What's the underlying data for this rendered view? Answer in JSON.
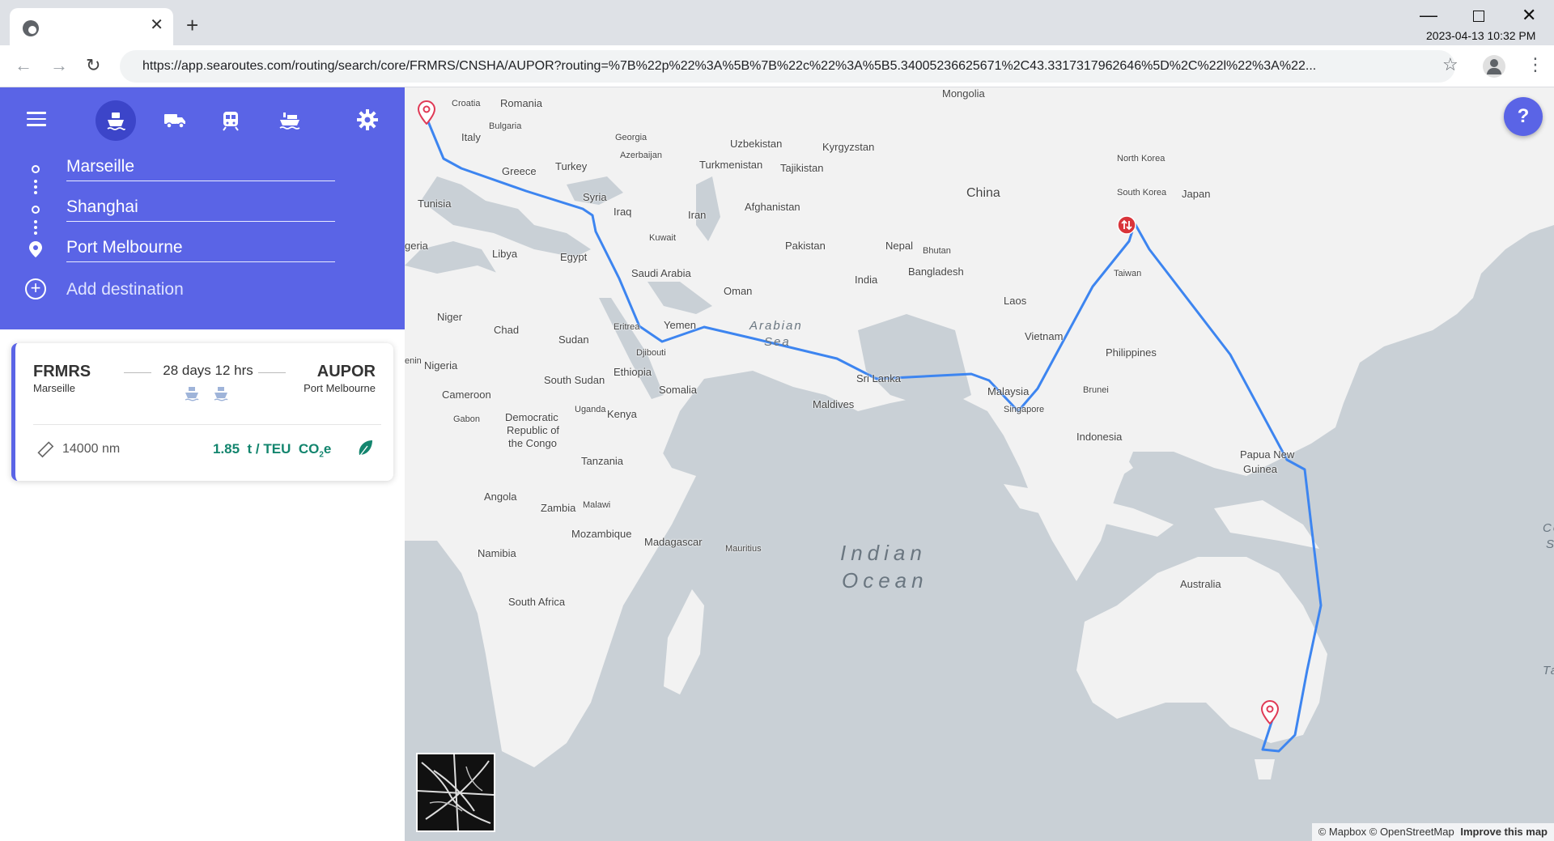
{
  "browser": {
    "tab_close": "✕",
    "new_tab": "+",
    "url": "https://app.searoutes.com/routing/search/core/FRMRS/CNSHA/AUPOR?routing=%7B%22p%22%3A%5B%7B%22c%22%3A%5B5.34005236625671%2C43.3317317962646%5D%2C%22l%22%3A%22...",
    "clock": "2023-04-13 10:32 PM",
    "icons": [
      "favicon-icon",
      "back-icon",
      "forward-icon",
      "reload-icon",
      "star-icon",
      "profile-icon",
      "menu-icon"
    ]
  },
  "sidebar": {
    "modes": [
      "ship-icon",
      "truck-icon",
      "train-icon",
      "port-icon"
    ],
    "waypoints": [
      {
        "label": "Marseille"
      },
      {
        "label": "Shanghai"
      },
      {
        "label": "Port Melbourne"
      }
    ],
    "add_destination": "Add destination",
    "colors": {
      "accent": "#5a64e6",
      "accent_dark": "#3c45c9",
      "co2": "#13856e"
    }
  },
  "route_card": {
    "from_code": "FRMRS",
    "from_name": "Marseille",
    "duration": "28 days 12 hrs",
    "to_code": "AUPOR",
    "to_name": "Port Melbourne",
    "distance": "14000  nm",
    "co2_value": "1.85",
    "co2_unit": "t / TEU",
    "co2_label_main": "CO",
    "co2_label_sub": "2",
    "co2_label_suffix": "e"
  },
  "map": {
    "help": "?",
    "attribution": "© Mapbox © OpenStreetMap",
    "improve": "Improve this map",
    "route_color": "#3d85f0",
    "labels": {
      "mongolia": "Mongolia",
      "romania": "Romania",
      "croatia": "Croatia",
      "bulgaria": "Bulgaria",
      "italy": "Italy",
      "georgia": "Georgia",
      "azerbaijan": "Azerbaijan",
      "uzbekistan": "Uzbekistan",
      "kyrgyzstan": "Kyrgyzstan",
      "north_korea": "North Korea",
      "japan": "Japan",
      "south_korea": "South Korea",
      "turkey": "Turkey",
      "greece": "Greece",
      "turkmenistan": "Turkmenistan",
      "tajikistan": "Tajikistan",
      "china": "China",
      "tunisia": "Tunisia",
      "syria": "Syria",
      "iraq": "Iraq",
      "iran": "Iran",
      "afghanistan": "Afghanistan",
      "algeria": "geria",
      "kuwait": "Kuwait",
      "libya": "Libya",
      "egypt": "Egypt",
      "pakistan": "Pakistan",
      "nepal": "Nepal",
      "bhutan": "Bhutan",
      "saudi": "Saudi Arabia",
      "bangladesh": "Bangladesh",
      "taiwan": "Taiwan",
      "india": "India",
      "oman": "Oman",
      "laos": "Laos",
      "niger": "Niger",
      "arabian": "Arabian",
      "sea": "Sea",
      "chad": "Chad",
      "sudan": "Sudan",
      "eritrea": "Eritrea",
      "yemen": "Yemen",
      "vietnam": "Vietnam",
      "philippines": "Philippines",
      "nigeria": "Nigeria",
      "benin": "enin",
      "djibouti": "Djibouti",
      "ethiopia": "Ethiopia",
      "south_sudan": "South Sudan",
      "sri_lanka": "Sri Lanka",
      "cameroon": "Cameroon",
      "somalia": "Somalia",
      "malaysia": "Malaysia",
      "brunei": "Brunei",
      "maldives": "Maldives",
      "singapore": "Singapore",
      "drc1": "Democratic",
      "drc2": "Republic of",
      "drc3": "the Congo",
      "uganda": "Uganda",
      "kenya": "Kenya",
      "gabon": "Gabon",
      "indonesia": "Indonesia",
      "png1": "Papua New",
      "png2": "Guinea",
      "tanzania": "Tanzania",
      "angola": "Angola",
      "zambia": "Zambia",
      "malawi": "Malawi",
      "mozambique": "Mozambique",
      "madagascar": "Madagascar",
      "mauritius": "Mauritius",
      "co1": "Co",
      "co2": "Se",
      "indian": "Indian",
      "ocean": "Ocean",
      "namibia": "Namibia",
      "australia": "Australia",
      "south_africa": "South Africa",
      "ta": "Ta"
    }
  }
}
